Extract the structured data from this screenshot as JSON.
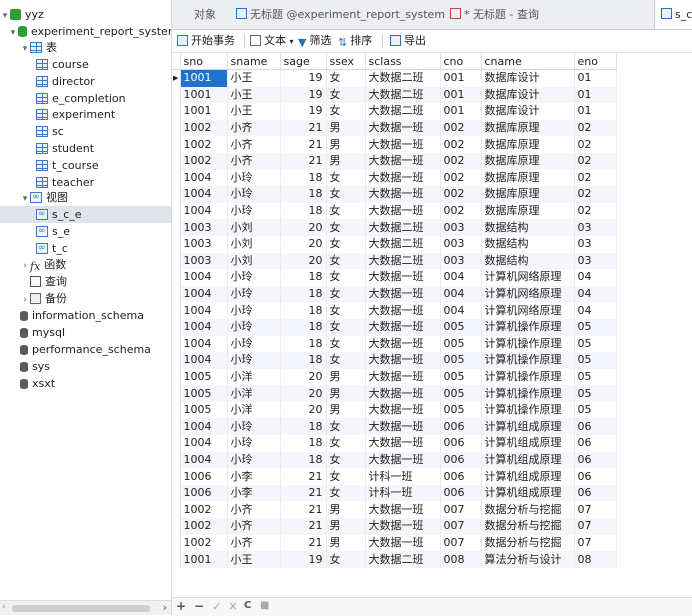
{
  "sidebar": {
    "connection": "yyz",
    "database": "experiment_report_system",
    "tables_group": "表",
    "tables": [
      "course",
      "director",
      "e_completion",
      "experiment",
      "sc",
      "student",
      "t_course",
      "teacher"
    ],
    "views_group": "视图",
    "views": [
      "s_c_e",
      "s_e",
      "t_c"
    ],
    "selected_view": "s_c_e",
    "functions": "函数",
    "queries": "查询",
    "backups": "备份",
    "other_databases": [
      "information_schema",
      "mysql",
      "performance_schema",
      "sys",
      "xsxt"
    ]
  },
  "tabs": [
    {
      "label": "对象",
      "icon": "none"
    },
    {
      "label": "无标题 @experiment_report_system ...",
      "icon": "query-icon"
    },
    {
      "label": "* 无标题 - 查询",
      "icon": "table-icon"
    },
    {
      "label": "s_c",
      "icon": "view-icon"
    }
  ],
  "toolbar": {
    "begin_transaction": "开始事务",
    "text": "文本",
    "filter": "筛选",
    "sort": "排序",
    "export": "导出"
  },
  "grid": {
    "columns": [
      "sno",
      "sname",
      "sage",
      "ssex",
      "sclass",
      "cno",
      "cname",
      "eno"
    ],
    "rows": [
      [
        "1001",
        "小王",
        "19",
        "女",
        "大数据二班",
        "001",
        "数据库设计",
        "01"
      ],
      [
        "1001",
        "小王",
        "19",
        "女",
        "大数据二班",
        "001",
        "数据库设计",
        "01"
      ],
      [
        "1001",
        "小王",
        "19",
        "女",
        "大数据二班",
        "001",
        "数据库设计",
        "01"
      ],
      [
        "1002",
        "小齐",
        "21",
        "男",
        "大数据一班",
        "002",
        "数据库原理",
        "02"
      ],
      [
        "1002",
        "小齐",
        "21",
        "男",
        "大数据一班",
        "002",
        "数据库原理",
        "02"
      ],
      [
        "1002",
        "小齐",
        "21",
        "男",
        "大数据一班",
        "002",
        "数据库原理",
        "02"
      ],
      [
        "1004",
        "小玲",
        "18",
        "女",
        "大数据一班",
        "002",
        "数据库原理",
        "02"
      ],
      [
        "1004",
        "小玲",
        "18",
        "女",
        "大数据一班",
        "002",
        "数据库原理",
        "02"
      ],
      [
        "1004",
        "小玲",
        "18",
        "女",
        "大数据一班",
        "002",
        "数据库原理",
        "02"
      ],
      [
        "1003",
        "小刘",
        "20",
        "女",
        "大数据二班",
        "003",
        "数据结构",
        "03"
      ],
      [
        "1003",
        "小刘",
        "20",
        "女",
        "大数据二班",
        "003",
        "数据结构",
        "03"
      ],
      [
        "1003",
        "小刘",
        "20",
        "女",
        "大数据二班",
        "003",
        "数据结构",
        "03"
      ],
      [
        "1004",
        "小玲",
        "18",
        "女",
        "大数据一班",
        "004",
        "计算机网络原理",
        "04"
      ],
      [
        "1004",
        "小玲",
        "18",
        "女",
        "大数据一班",
        "004",
        "计算机网络原理",
        "04"
      ],
      [
        "1004",
        "小玲",
        "18",
        "女",
        "大数据一班",
        "004",
        "计算机网络原理",
        "04"
      ],
      [
        "1004",
        "小玲",
        "18",
        "女",
        "大数据一班",
        "005",
        "计算机操作原理",
        "05"
      ],
      [
        "1004",
        "小玲",
        "18",
        "女",
        "大数据一班",
        "005",
        "计算机操作原理",
        "05"
      ],
      [
        "1004",
        "小玲",
        "18",
        "女",
        "大数据一班",
        "005",
        "计算机操作原理",
        "05"
      ],
      [
        "1005",
        "小洋",
        "20",
        "男",
        "大数据一班",
        "005",
        "计算机操作原理",
        "05"
      ],
      [
        "1005",
        "小洋",
        "20",
        "男",
        "大数据一班",
        "005",
        "计算机操作原理",
        "05"
      ],
      [
        "1005",
        "小洋",
        "20",
        "男",
        "大数据一班",
        "005",
        "计算机操作原理",
        "05"
      ],
      [
        "1004",
        "小玲",
        "18",
        "女",
        "大数据一班",
        "006",
        "计算机组成原理",
        "06"
      ],
      [
        "1004",
        "小玲",
        "18",
        "女",
        "大数据一班",
        "006",
        "计算机组成原理",
        "06"
      ],
      [
        "1004",
        "小玲",
        "18",
        "女",
        "大数据一班",
        "006",
        "计算机组成原理",
        "06"
      ],
      [
        "1006",
        "小李",
        "21",
        "女",
        "计科一班",
        "006",
        "计算机组成原理",
        "06"
      ],
      [
        "1006",
        "小李",
        "21",
        "女",
        "计科一班",
        "006",
        "计算机组成原理",
        "06"
      ],
      [
        "1002",
        "小齐",
        "21",
        "男",
        "大数据一班",
        "007",
        "数据分析与挖掘",
        "07"
      ],
      [
        "1002",
        "小齐",
        "21",
        "男",
        "大数据一班",
        "007",
        "数据分析与挖掘",
        "07"
      ],
      [
        "1002",
        "小齐",
        "21",
        "男",
        "大数据一班",
        "007",
        "数据分析与挖掘",
        "07"
      ],
      [
        "1001",
        "小王",
        "19",
        "女",
        "大数据二班",
        "008",
        "算法分析与设计",
        "08"
      ]
    ]
  },
  "bottom_bar": {
    "add": "+",
    "remove": "−",
    "confirm": "✓",
    "cancel": "×",
    "refresh": "C",
    "stop": "■"
  },
  "colors": {
    "selection": "#1e73d2",
    "alt_row": "#f4f6fb",
    "db_green": "#2e9e3a",
    "table_blue": "#3a78c8"
  }
}
